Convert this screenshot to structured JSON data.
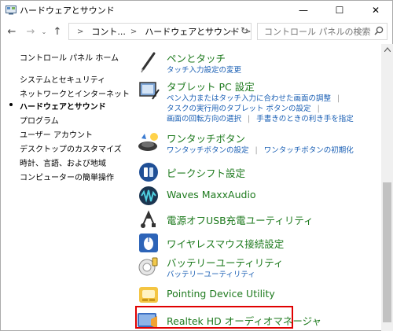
{
  "window": {
    "title": "ハードウェアとサウンド",
    "minimize_glyph": "—",
    "maximize_glyph": "☐",
    "close_glyph": "✕"
  },
  "nav": {
    "back_glyph": "←",
    "forward_glyph": "→",
    "recent_glyph": "⌄",
    "up_glyph": "↑",
    "breadcrumb_sep": ">",
    "crumbs": [
      "コント...",
      "ハードウェアとサウンド"
    ],
    "dropdown_glyph": "⌄",
    "refresh_glyph": "↻"
  },
  "search": {
    "placeholder": "コントロール パネルの検索"
  },
  "sidebar": {
    "items": [
      {
        "label": "コントロール パネル ホーム",
        "active": false
      },
      {
        "label": "システムとセキュリティ",
        "active": false
      },
      {
        "label": "ネットワークとインターネット",
        "active": false
      },
      {
        "label": "ハードウェアとサウンド",
        "active": true
      },
      {
        "label": "プログラム",
        "active": false
      },
      {
        "label": "ユーザー アカウント",
        "active": false
      },
      {
        "label": "デスクトップのカスタマイズ",
        "active": false
      },
      {
        "label": "時計、言語、および地域",
        "active": false
      },
      {
        "label": "コンピューターの簡単操作",
        "active": false
      }
    ]
  },
  "categories": [
    {
      "title": "ペンとタッチ",
      "links": [
        "タッチ入力設定の変更"
      ],
      "icon": "pen-icon"
    },
    {
      "title": "タブレット PC 設定",
      "links": [
        "ペン入力またはタッチ入力に合わせた画面の調整"
      ],
      "links2": [
        "タスクの実行用のタブレット ボタンの設定"
      ],
      "links3": [
        "画面の回転方向の選択",
        "手書きのときの利き手を指定"
      ],
      "icon": "tablet-icon"
    },
    {
      "title": "ワンタッチボタン",
      "links": [
        "ワンタッチボタンの設定",
        "ワンタッチボタンの初期化"
      ],
      "icon": "onetouch-button-icon"
    },
    {
      "title": "ピークシフト設定",
      "links": [],
      "icon": "peak-shift-icon"
    },
    {
      "title": "Waves MaxxAudio",
      "links": [],
      "icon": "waves-icon"
    },
    {
      "title": "電源オフUSB充電ユーティリティ",
      "links": [],
      "icon": "usb-icon"
    },
    {
      "title": "ワイヤレスマウス接続設定",
      "links": [],
      "icon": "wireless-mouse-icon"
    },
    {
      "title": "バッテリーユーティリティ",
      "links": [
        "バッテリーユーティリティ"
      ],
      "icon": "battery-icon"
    },
    {
      "title": "Pointing Device Utility",
      "links": [],
      "icon": "pointing-device-icon"
    },
    {
      "title": "Realtek HD オーディオマネージャ",
      "links": [],
      "icon": "realtek-audio-icon"
    }
  ],
  "colors": {
    "category_title": "#1e7a1e",
    "link": "#1a5fb4",
    "highlight_border": "#e00000"
  }
}
